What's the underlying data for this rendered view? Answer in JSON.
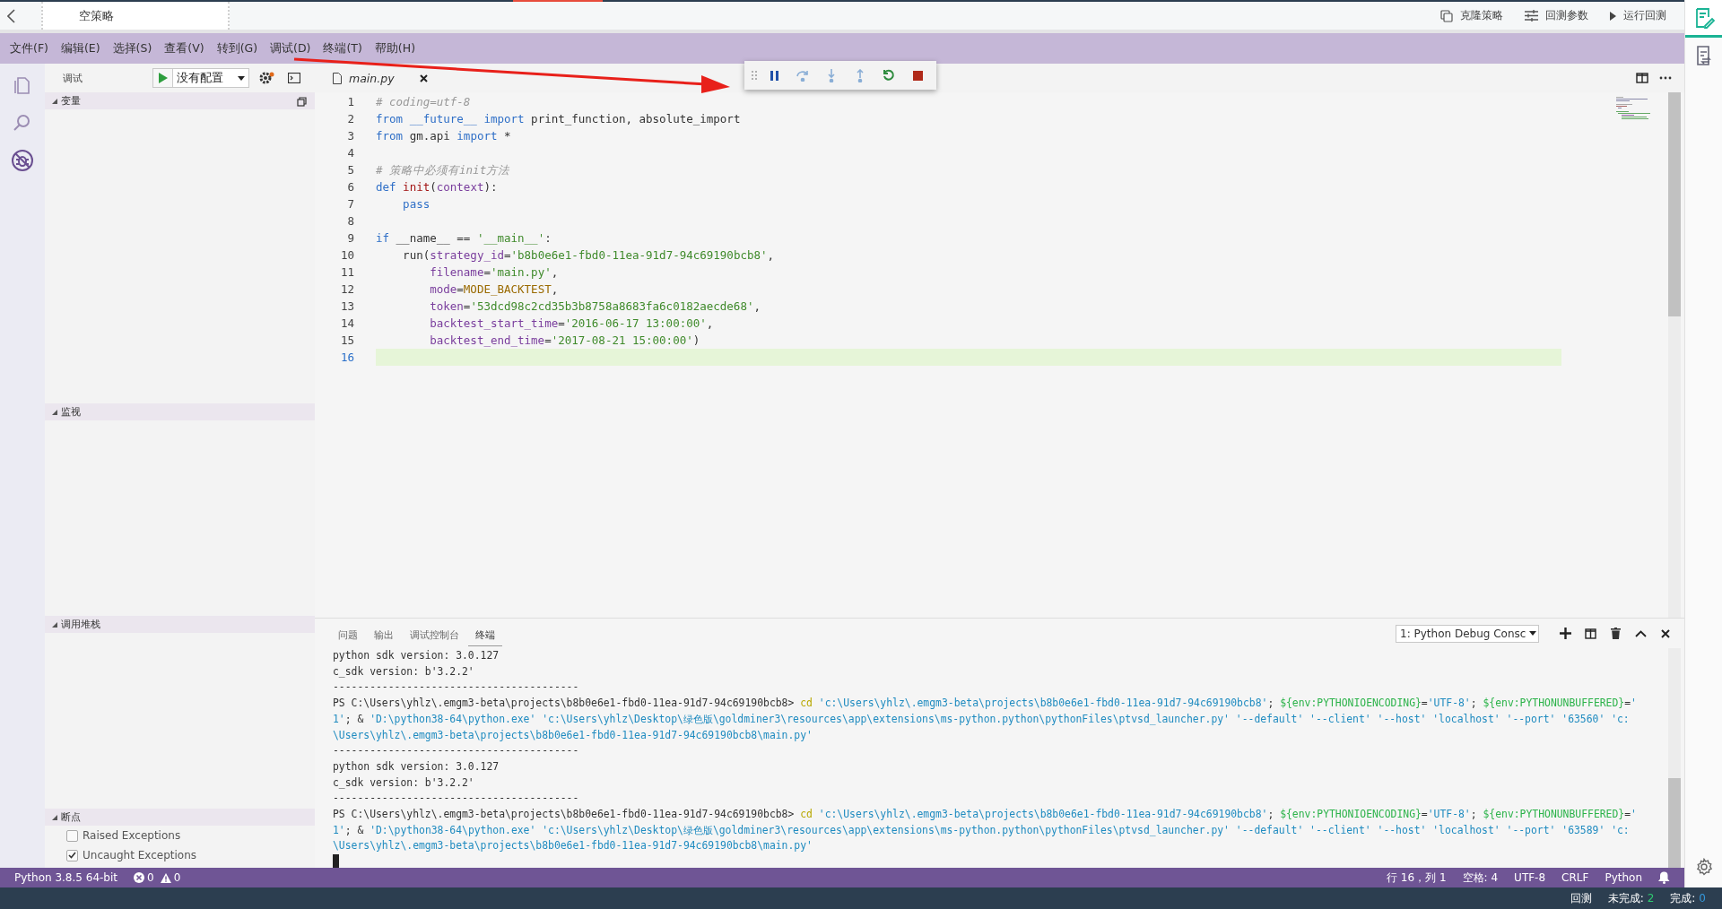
{
  "title_bar": {
    "title": "空策略",
    "actions": [
      {
        "kind": "clone",
        "label": "克隆策略"
      },
      {
        "kind": "sliders",
        "label": "回测参数"
      },
      {
        "kind": "play",
        "label": "运行回测"
      }
    ]
  },
  "right_rail": [
    {
      "kind": "edit",
      "selected": true
    },
    {
      "kind": "log",
      "selected": false
    }
  ],
  "menu": [
    "文件(F)",
    "编辑(E)",
    "选择(S)",
    "查看(V)",
    "转到(G)",
    "调试(D)",
    "终端(T)",
    "帮助(H)"
  ],
  "activity_bar": [
    {
      "kind": "files",
      "selected": false
    },
    {
      "kind": "search",
      "selected": false
    },
    {
      "kind": "debug",
      "selected": true
    }
  ],
  "debug_sidebar": {
    "title": "调试",
    "config": "没有配置",
    "sections": [
      {
        "kind": "variables",
        "title": "变量",
        "expanded": true
      },
      {
        "kind": "watch",
        "title": "监视",
        "expanded": true
      },
      {
        "kind": "stack",
        "title": "调用堆栈",
        "expanded": true
      },
      {
        "kind": "breakpoints",
        "title": "断点",
        "expanded": true
      }
    ],
    "breakpoints": [
      {
        "label": "Raised Exceptions",
        "checked": false
      },
      {
        "label": "Uncaught Exceptions",
        "checked": true
      }
    ]
  },
  "editor": {
    "tabs": [
      {
        "label": "main.py",
        "selected": true
      }
    ],
    "lines": [
      {
        "number": "1",
        "current": false,
        "tokens": [
          {
            "kind": "comment",
            "text": "# coding=utf-8"
          }
        ]
      },
      {
        "number": "2",
        "current": false,
        "tokens": [
          {
            "kind": "keyword",
            "text": "from"
          },
          {
            "kind": "keyword",
            "text": " __future__"
          },
          {
            "kind": "keyword",
            "text": " import"
          },
          {
            "kind": "plain",
            "text": " print_function, absolute_import"
          }
        ]
      },
      {
        "number": "3",
        "current": false,
        "tokens": [
          {
            "kind": "keyword",
            "text": "from"
          },
          {
            "kind": "plain",
            "text": " gm.api "
          },
          {
            "kind": "keyword",
            "text": "import"
          },
          {
            "kind": "plain",
            "text": " *"
          }
        ]
      },
      {
        "number": "4",
        "current": false
      },
      {
        "number": "5",
        "current": false,
        "tokens": [
          {
            "kind": "comment",
            "text": "# 策略中必须有init方法"
          }
        ]
      },
      {
        "number": "6",
        "current": false,
        "tokens": [
          {
            "kind": "keyword",
            "text": "def"
          },
          {
            "kind": "function",
            "text": " init"
          },
          {
            "kind": "plain",
            "text": "("
          },
          {
            "kind": "param",
            "text": "context"
          },
          {
            "kind": "plain",
            "text": "):"
          }
        ]
      },
      {
        "number": "7",
        "current": false,
        "tokens": [
          {
            "kind": "keyword",
            "text": "    pass"
          }
        ]
      },
      {
        "number": "8",
        "current": false
      },
      {
        "number": "9",
        "current": false,
        "tokens": [
          {
            "kind": "keyword",
            "text": "if"
          },
          {
            "kind": "plain",
            "text": " __name__ == "
          },
          {
            "kind": "string",
            "text": "'__main__'"
          },
          {
            "kind": "plain",
            "text": ":"
          }
        ]
      },
      {
        "number": "10",
        "current": false,
        "tokens": [
          {
            "kind": "plain",
            "text": "    run("
          },
          {
            "kind": "param",
            "text": "strategy_id"
          },
          {
            "kind": "plain",
            "text": "="
          },
          {
            "kind": "string",
            "text": "'b8b0e6e1-fbd0-11ea-91d7-94c69190bcb8'"
          },
          {
            "kind": "plain",
            "text": ","
          }
        ]
      },
      {
        "number": "11",
        "current": false,
        "tokens": [
          {
            "kind": "param",
            "text": "        filename"
          },
          {
            "kind": "plain",
            "text": "="
          },
          {
            "kind": "string",
            "text": "'main.py'"
          },
          {
            "kind": "plain",
            "text": ","
          }
        ]
      },
      {
        "number": "12",
        "current": false,
        "tokens": [
          {
            "kind": "param",
            "text": "        mode"
          },
          {
            "kind": "plain",
            "text": "="
          },
          {
            "kind": "constant",
            "text": "MODE_BACKTEST"
          },
          {
            "kind": "plain",
            "text": ","
          }
        ]
      },
      {
        "number": "13",
        "current": false,
        "tokens": [
          {
            "kind": "param",
            "text": "        token"
          },
          {
            "kind": "plain",
            "text": "="
          },
          {
            "kind": "string",
            "text": "'53dcd98c2cd35b3b8758a8683fa6c0182aecde68'"
          },
          {
            "kind": "plain",
            "text": ","
          }
        ]
      },
      {
        "number": "14",
        "current": false,
        "tokens": [
          {
            "kind": "param",
            "text": "        backtest_start_time"
          },
          {
            "kind": "plain",
            "text": "="
          },
          {
            "kind": "string",
            "text": "'2016-06-17 13:00:00'"
          },
          {
            "kind": "plain",
            "text": ","
          }
        ]
      },
      {
        "number": "15",
        "current": false,
        "tokens": [
          {
            "kind": "param",
            "text": "        backtest_end_time"
          },
          {
            "kind": "plain",
            "text": "="
          },
          {
            "kind": "string",
            "text": "'2017-08-21 15:00:00'"
          },
          {
            "kind": "plain",
            "text": ")"
          }
        ]
      },
      {
        "number": "16",
        "current": true
      }
    ]
  },
  "panel": {
    "tabs": [
      {
        "label": "问题",
        "selected": false
      },
      {
        "label": "输出",
        "selected": false
      },
      {
        "label": "调试控制台",
        "selected": false
      },
      {
        "label": "终端",
        "selected": true
      }
    ],
    "terminal_select": "1: Python Debug Consc",
    "lines": [
      {
        "segments": [
          {
            "kind": "plain",
            "text": "python sdk version: 3.0.127"
          }
        ]
      },
      {
        "segments": [
          {
            "kind": "plain",
            "text": "c_sdk version: b'3.2.2'"
          }
        ]
      },
      {
        "segments": [
          {
            "kind": "plain",
            "text": "----------------------------------------"
          }
        ]
      },
      {
        "segments": [
          {
            "kind": "plain",
            "text": "PS C:\\Users\\yhlz\\.emgm3-beta\\projects\\b8b0e6e1-fbd0-11ea-91d7-94c69190bcb8> "
          },
          {
            "kind": "command",
            "text": "cd"
          },
          {
            "kind": "string",
            "text": " 'c:\\Users\\yhlz\\.emgm3-beta\\projects\\b8b0e6e1-fbd0-11ea-91d7-94c69190bcb8'"
          },
          {
            "kind": "plain",
            "text": "; "
          },
          {
            "kind": "variable",
            "text": "${env:PYTHONIOENCODING}"
          },
          {
            "kind": "plain",
            "text": "="
          },
          {
            "kind": "string",
            "text": "'UTF-8'"
          },
          {
            "kind": "plain",
            "text": "; "
          },
          {
            "kind": "variable",
            "text": "${env:PYTHONUNBUFFERED}"
          },
          {
            "kind": "plain",
            "text": "="
          },
          {
            "kind": "string",
            "text": "'"
          }
        ]
      },
      {
        "segments": [
          {
            "kind": "string",
            "text": "1'"
          },
          {
            "kind": "plain",
            "text": "; & "
          },
          {
            "kind": "string",
            "text": "'D:\\python38-64\\python.exe' 'c:\\Users\\yhlz\\Desktop\\绿色版\\goldminer3\\resources\\app\\extensions\\ms-python.python\\pythonFiles\\ptvsd_launcher.py' '--default' '--client' '--host' 'localhost' '--port' '63560' 'c:"
          }
        ]
      },
      {
        "segments": [
          {
            "kind": "string",
            "text": "\\Users\\yhlz\\.emgm3-beta\\projects\\b8b0e6e1-fbd0-11ea-91d7-94c69190bcb8\\main.py'"
          }
        ]
      },
      {
        "segments": [
          {
            "kind": "plain",
            "text": "----------------------------------------"
          }
        ]
      },
      {
        "segments": [
          {
            "kind": "plain",
            "text": "python sdk version: 3.0.127"
          }
        ]
      },
      {
        "segments": [
          {
            "kind": "plain",
            "text": "c_sdk version: b'3.2.2'"
          }
        ]
      },
      {
        "segments": [
          {
            "kind": "plain",
            "text": "----------------------------------------"
          }
        ]
      },
      {
        "segments": [
          {
            "kind": "plain",
            "text": "PS C:\\Users\\yhlz\\.emgm3-beta\\projects\\b8b0e6e1-fbd0-11ea-91d7-94c69190bcb8> "
          },
          {
            "kind": "command",
            "text": "cd"
          },
          {
            "kind": "string",
            "text": " 'c:\\Users\\yhlz\\.emgm3-beta\\projects\\b8b0e6e1-fbd0-11ea-91d7-94c69190bcb8'"
          },
          {
            "kind": "plain",
            "text": "; "
          },
          {
            "kind": "variable",
            "text": "${env:PYTHONIOENCODING}"
          },
          {
            "kind": "plain",
            "text": "="
          },
          {
            "kind": "string",
            "text": "'UTF-8'"
          },
          {
            "kind": "plain",
            "text": "; "
          },
          {
            "kind": "variable",
            "text": "${env:PYTHONUNBUFFERED}"
          },
          {
            "kind": "plain",
            "text": "="
          },
          {
            "kind": "string",
            "text": "'"
          }
        ]
      },
      {
        "segments": [
          {
            "kind": "string",
            "text": "1'"
          },
          {
            "kind": "plain",
            "text": "; & "
          },
          {
            "kind": "string",
            "text": "'D:\\python38-64\\python.exe' 'c:\\Users\\yhlz\\Desktop\\绿色版\\goldminer3\\resources\\app\\extensions\\ms-python.python\\pythonFiles\\ptvsd_launcher.py' '--default' '--client' '--host' 'localhost' '--port' '63589' 'c:"
          }
        ]
      },
      {
        "segments": [
          {
            "kind": "string",
            "text": "\\Users\\yhlz\\.emgm3-beta\\projects\\b8b0e6e1-fbd0-11ea-91d7-94c69190bcb8\\main.py'"
          }
        ]
      }
    ]
  },
  "status_bar": {
    "interpreter": "Python 3.8.5 64-bit",
    "errors": "0",
    "warnings": "0",
    "position": "行 16，列 1",
    "indent": "空格: 4",
    "encoding": "UTF-8",
    "eol": "CRLF",
    "language": "Python"
  },
  "bottom_bar": {
    "label": "回测",
    "pending_label": "未完成:",
    "pending": "2",
    "done_label": "完成:",
    "done": "0"
  }
}
